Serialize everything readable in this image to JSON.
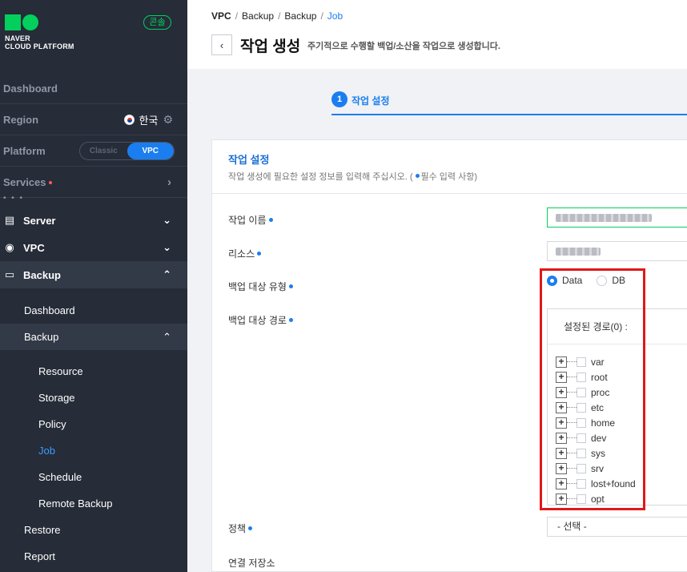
{
  "sidebar": {
    "logo_line1": "NAVER",
    "logo_line2": "CLOUD PLATFORM",
    "console_badge": "콘솔",
    "dashboard": "Dashboard",
    "region_label": "Region",
    "region_value": "한국",
    "platform_label": "Platform",
    "platform_options": [
      "Classic",
      "VPC"
    ],
    "platform_selected": "VPC",
    "services_label": "Services",
    "menu": [
      {
        "label": "Server",
        "icon": "server-icon",
        "expanded": false
      },
      {
        "label": "VPC",
        "icon": "vpc-icon",
        "expanded": false
      },
      {
        "label": "Backup",
        "icon": "backup-icon",
        "expanded": true
      }
    ],
    "backup_sub": {
      "dashboard": "Dashboard",
      "backup": "Backup",
      "items": [
        "Resource",
        "Storage",
        "Policy",
        "Job",
        "Schedule",
        "Remote Backup"
      ],
      "current": "Job",
      "restore": "Restore",
      "report": "Report"
    }
  },
  "header": {
    "breadcrumb": [
      "VPC",
      "Backup",
      "Backup",
      "Job"
    ],
    "title": "작업 생성",
    "description": "주기적으로 수행할 백업/소산을 작업으로 생성합니다."
  },
  "steps": [
    {
      "num": "1",
      "label": "작업 설정"
    }
  ],
  "panel": {
    "title": "작업 설정",
    "subtitle_before": "작업 생성에 필요한 설정 정보를 입력해 주십시오. (",
    "subtitle_after": "필수 입력 사항)",
    "fields": {
      "job_name": "작업 이름",
      "resource": "리소스",
      "target_type": "백업 대상 유형",
      "target_path": "백업 대상 경로",
      "policy": "정책",
      "storage": "연결 저장소"
    },
    "target_type_options": [
      "Data",
      "DB"
    ],
    "target_type_selected": "Data",
    "tree_header": "설정된 경로(0) :",
    "tree_items": [
      "var",
      "root",
      "proc",
      "etc",
      "home",
      "dev",
      "sys",
      "srv",
      "lost+found",
      "opt"
    ],
    "policy_select": "- 선택 -"
  },
  "colors": {
    "sidebar_bg": "#262c38",
    "accent": "#1b7ef0",
    "brand_green": "#03cf5d",
    "highlight": "#e01818"
  }
}
